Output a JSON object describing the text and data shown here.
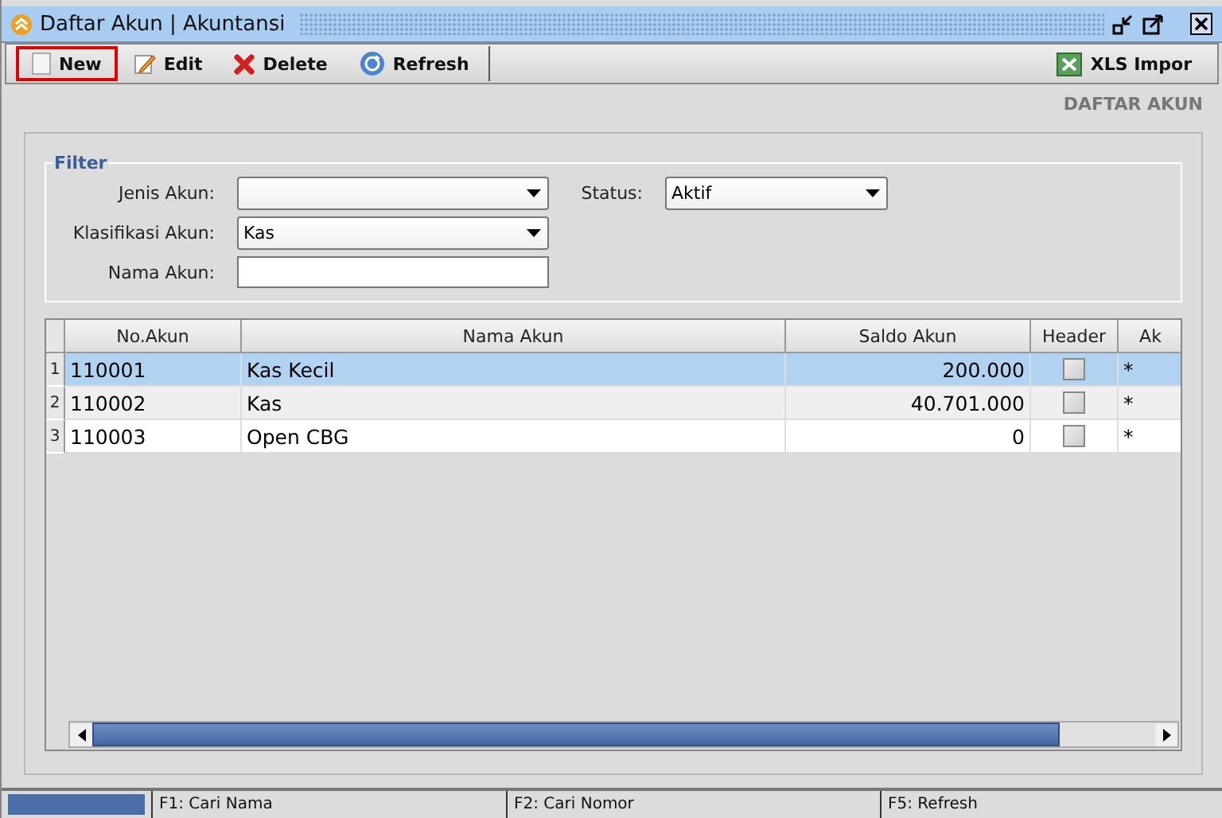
{
  "window": {
    "title": "Daftar Akun | Akuntansi"
  },
  "toolbar": [
    {
      "label": "New",
      "kind": "new",
      "highlighted": true
    },
    {
      "label": "Edit",
      "kind": "edit",
      "highlighted": false
    },
    {
      "label": "Delete",
      "kind": "delete",
      "highlighted": false
    },
    {
      "label": "Refresh",
      "kind": "refresh",
      "highlighted": false
    }
  ],
  "import_button": {
    "label": "XLS Impor"
  },
  "page_heading": "DAFTAR AKUN",
  "filter": {
    "title": "Filter",
    "jenis_akun": {
      "label": "Jenis Akun:"
    },
    "status": {
      "label": "Status:",
      "value": "Aktif"
    },
    "klasifikasi_akun": {
      "label": "Klasifikasi Akun:",
      "value": "Kas"
    },
    "nama_akun": {
      "label": "Nama Akun:"
    }
  },
  "table": {
    "columns": [
      "No.Akun",
      "Nama Akun",
      "Saldo Akun",
      "Header",
      "Ak"
    ],
    "rows": [
      {
        "number": "1",
        "no_akun": "110001",
        "nama_akun": "Kas Kecil",
        "saldo": "200.000",
        "header": false,
        "column_5": "*",
        "selected": true
      },
      {
        "number": "2",
        "no_akun": "110002",
        "nama_akun": "Kas",
        "saldo": "40.701.000",
        "header": false,
        "column_5": "*",
        "selected": false
      },
      {
        "number": "3",
        "no_akun": "110003",
        "nama_akun": "Open CBG",
        "saldo": "0",
        "header": false,
        "column_5": "*",
        "selected": false
      }
    ]
  },
  "status_bar": [
    "F1: Cari Nama",
    "F2: Cari Nomor",
    "F5: Refresh"
  ]
}
